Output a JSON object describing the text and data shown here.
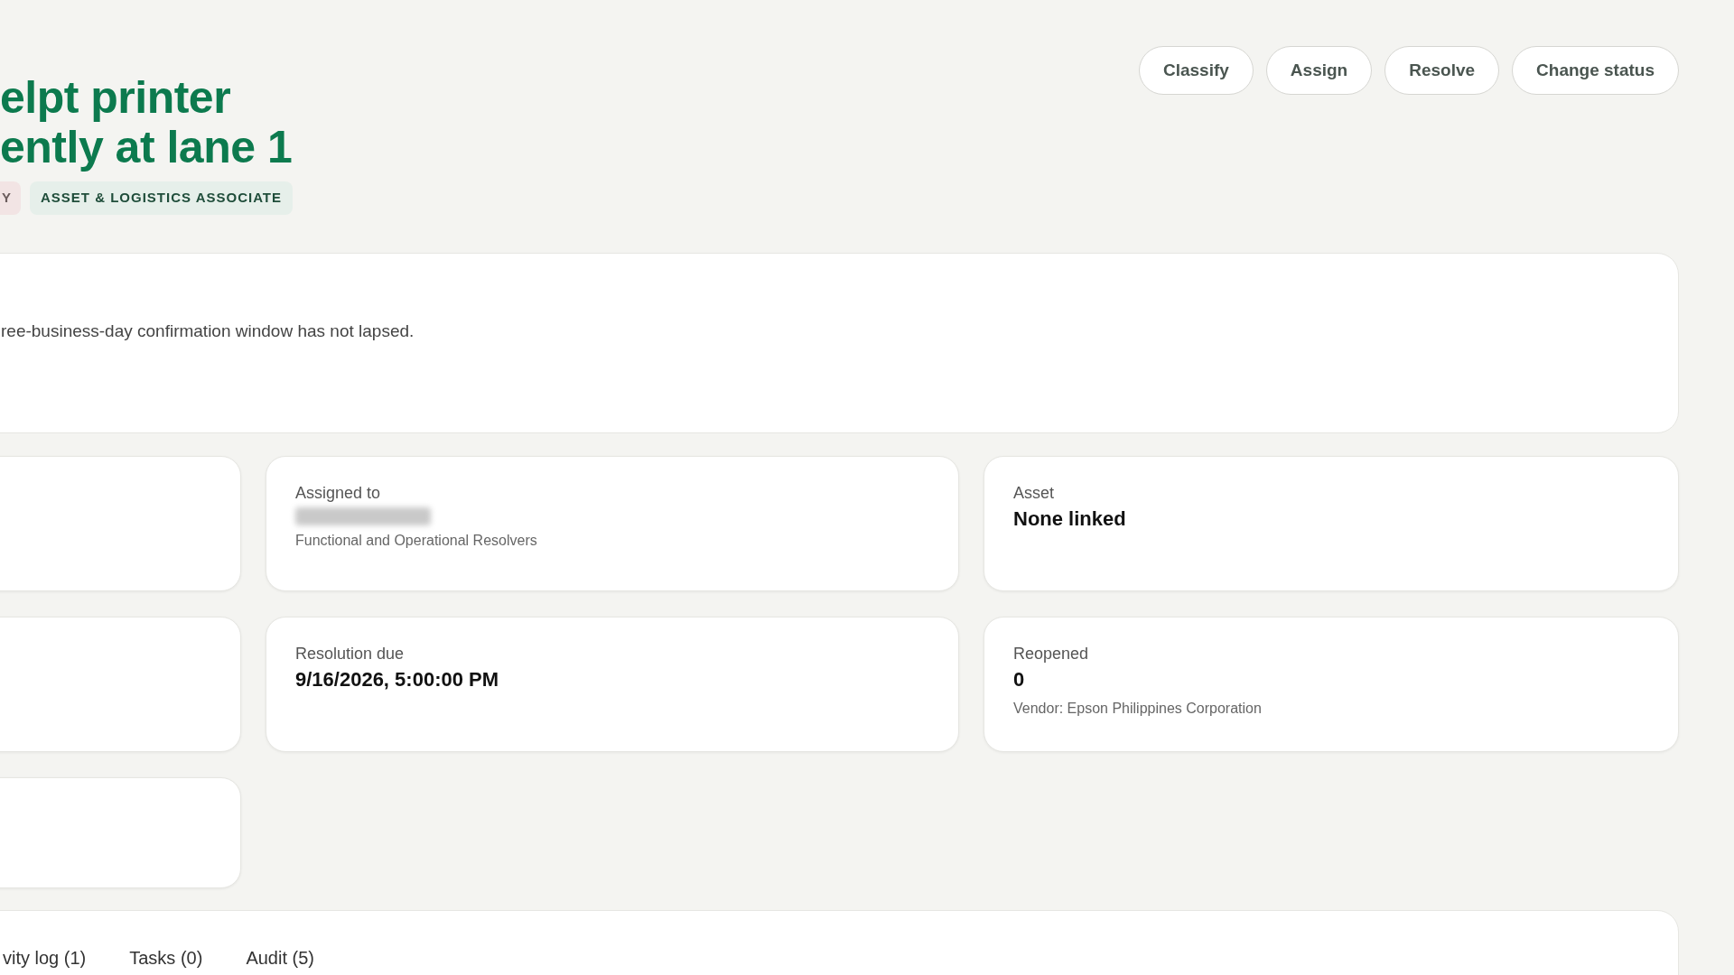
{
  "title_lines": [
    "elpt printer",
    "ently at lane 1"
  ],
  "badges": [
    {
      "text": "Y",
      "color": "#f2e4e4"
    },
    {
      "text": "ASSET & LOGISTICS ASSOCIATE",
      "color": "#e6efea"
    }
  ],
  "actions": [
    "Classify",
    "Assign",
    "Resolve",
    "Change status"
  ],
  "notice": {
    "text": "ree-business-day confirmation window has not lapsed."
  },
  "cards": [
    {
      "kind": "empty"
    },
    {
      "kind": "field",
      "label": "Assigned to",
      "redacted": true,
      "sub": "Functional and Operational Resolvers"
    },
    {
      "kind": "field",
      "label": "Asset",
      "value": "None linked"
    },
    {
      "kind": "empty"
    },
    {
      "kind": "field",
      "label": "Resolution due",
      "value": "9/16/2026, 5:00:00 PM"
    },
    {
      "kind": "field",
      "label": "Reopened",
      "value": "0",
      "sub": "Vendor: Epson Philippines Corporation"
    },
    {
      "kind": "empty"
    }
  ],
  "tabs": [
    {
      "label": "vity log (1)"
    },
    {
      "label": "Tasks (0)"
    },
    {
      "label": "Audit (5)"
    }
  ]
}
